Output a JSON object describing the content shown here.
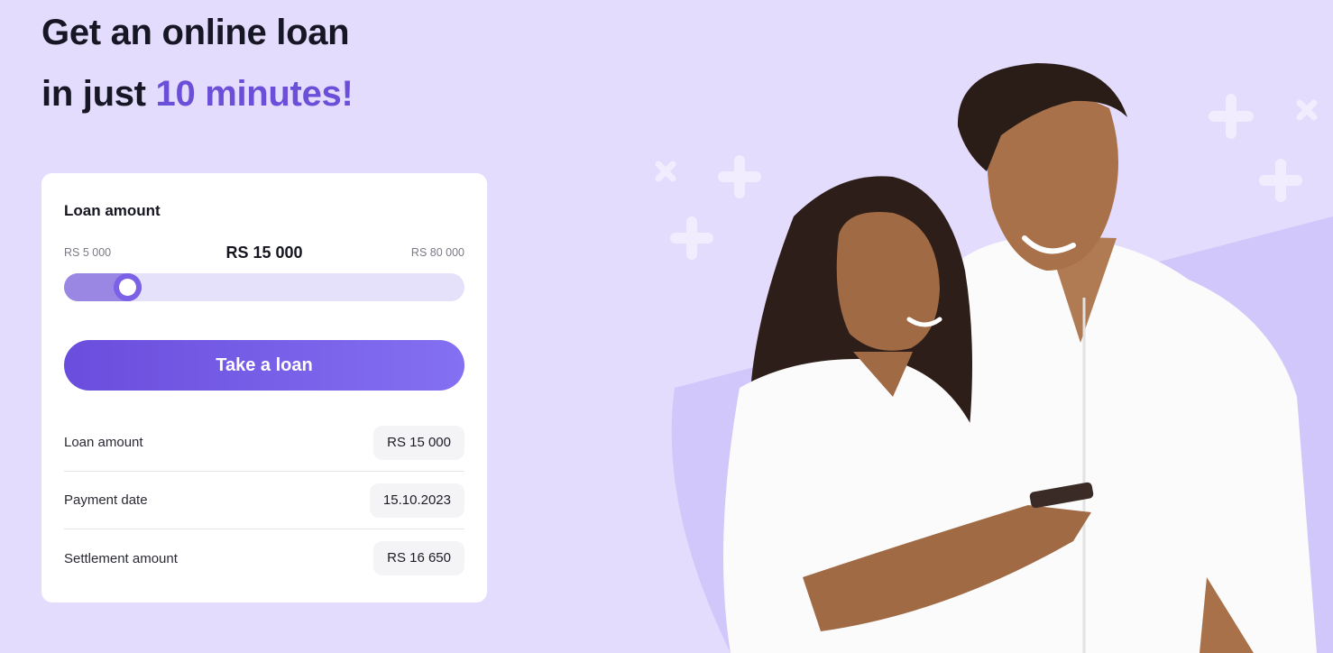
{
  "hero": {
    "line1": "Get an online loan",
    "line2_prefix": "in just ",
    "line2_accent": "10 minutes!"
  },
  "calculator": {
    "label": "Loan amount",
    "min_label": "RS 5 000",
    "max_label": "RS 80 000",
    "current_label": "RS 15 000",
    "slider_fraction": 0.133,
    "button_label": "Take a loan",
    "summary": [
      {
        "label": "Loan amount",
        "value": "RS 15 000"
      },
      {
        "label": "Payment date",
        "value": "15.10.2023"
      },
      {
        "label": "Settlement amount",
        "value": "RS 16 650"
      }
    ]
  },
  "colors": {
    "background": "#e3dcfc",
    "accent": "#6b4fd8",
    "button": "#7258e6"
  },
  "illustration": {
    "subject": "smiling-couple-looking-at-phone",
    "decorations": [
      "plus-icon",
      "cross-icon"
    ]
  }
}
